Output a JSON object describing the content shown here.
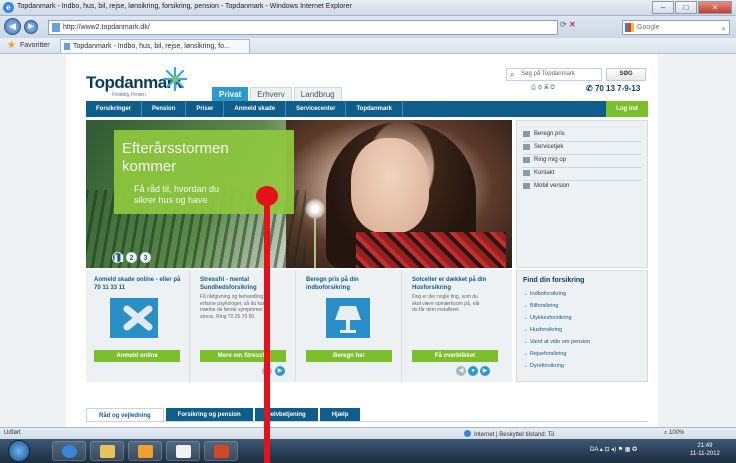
{
  "browser": {
    "title": "Topdanmark - Indbo, hus, bil, rejse, lønsikring, forsikring, pension - Topdanmark - Windows Internet Explorer",
    "url": "http://www2.topdanmark.dk/",
    "search_engine": "Google",
    "favorites_label": "Favoritter",
    "tab_title": "Topdanmark - Indbo, hus, bil, rejse, lønsikring, fo...",
    "status_left": "Udført",
    "status_zone": "Internet | Beskyttet tilstand: Til",
    "zoom": "100%"
  },
  "site": {
    "logo_text": "Topdanmark",
    "logo_tagline": "Forsikring, Pension",
    "search_placeholder": "Søg på Topdanmark",
    "search_button": "SØG",
    "phone": "70 13 7-9-13",
    "tabs": [
      "Privat",
      "Erhverv",
      "Landbrug"
    ],
    "nav": [
      "Forsikringer",
      "Pension",
      "Priser",
      "Anmeld skade",
      "Servicecenter",
      "Topdanmark"
    ],
    "login": "Log ind"
  },
  "hero": {
    "headline_1": "Efterårsstormen",
    "headline_2": "kommer",
    "sub_1": "Få råd til, hvordan du",
    "sub_2": "sikrer hus og have",
    "pager": [
      "",
      "2",
      "3"
    ]
  },
  "quicklinks": [
    "Beregn pris",
    "Servicetjek",
    "Ring mig op",
    "Kontakt",
    "Mobil version"
  ],
  "cards": [
    {
      "title": "Anmeld skade online - eller på 70 11 33 11",
      "desc": "",
      "button": "Anmeld online"
    },
    {
      "title": "Stressfri - mental Sundhedsforsikring",
      "desc": "Få rådgivning og behandling af erfarne psykologer, så du kan mærke de første symptomer på stress. Ring 70 25 70 50.",
      "button": "Mere om Stressfri"
    },
    {
      "title": "Beregn pris på din indboforsikring",
      "desc": "",
      "button": "Beregn her"
    },
    {
      "title": "Solceller er dækket på din Husforsikring",
      "desc": "Dog er der nogle ting, som du skal være opmærksom på, når du får dem installeret.",
      "button": "Få overblikket"
    }
  ],
  "find": {
    "heading": "Find din forsikring",
    "items": [
      "Indboforsikring",
      "Bilforsikring",
      "Ulykkesforsikring",
      "Husforsikring",
      "Vand at vide om pension",
      "Rejseforsikring",
      "Dyreforsikring"
    ]
  },
  "bottom_tabs": [
    "Råd og vejledning",
    "Forsikring og pension",
    "Selvbetjening",
    "Hjælp"
  ],
  "taskbar": {
    "lang": "DA",
    "time": "21:49",
    "date": "11-11-2012"
  }
}
